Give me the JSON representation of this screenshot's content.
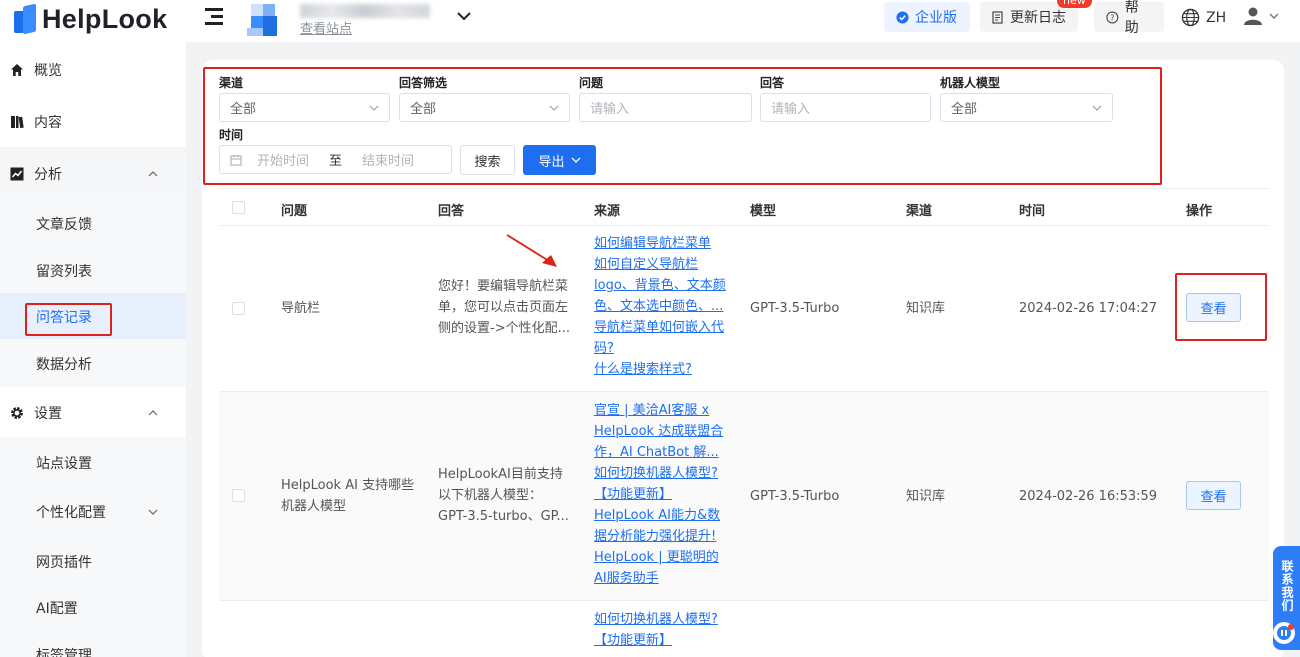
{
  "header": {
    "logo_text": "HelpLook",
    "site_link": "查看站点",
    "enterprise_label": "企业版",
    "changelog_label": "更新日志",
    "new_badge": "new",
    "help_label": "帮助",
    "lang_label": "ZH"
  },
  "sidebar": {
    "items": [
      {
        "label": "概览",
        "icon": "home-icon"
      },
      {
        "label": "内容",
        "icon": "book-icon"
      },
      {
        "label": "分析",
        "icon": "chart-icon"
      },
      {
        "label": "文章反馈"
      },
      {
        "label": "留资列表"
      },
      {
        "label": "问答记录"
      },
      {
        "label": "数据分析"
      },
      {
        "label": "设置",
        "icon": "gear-icon"
      },
      {
        "label": "站点设置"
      },
      {
        "label": "个性化配置"
      },
      {
        "label": "网页插件"
      },
      {
        "label": "AI配置"
      },
      {
        "label": "标签管理"
      }
    ]
  },
  "filters": {
    "channel_label": "渠道",
    "channel_value": "全部",
    "answer_filter_label": "回答筛选",
    "answer_filter_value": "全部",
    "question_label": "问题",
    "question_placeholder": "请输入",
    "answer_label": "回答",
    "answer_placeholder": "请输入",
    "model_label": "机器人模型",
    "model_value": "全部",
    "time_label": "时间",
    "start_placeholder": "开始时间",
    "range_sep": "至",
    "end_placeholder": "结束时间",
    "search_button": "搜索",
    "export_button": "导出"
  },
  "table": {
    "columns": [
      "问题",
      "回答",
      "来源",
      "模型",
      "渠道",
      "时间",
      "操作"
    ],
    "rows": [
      {
        "question": "导航栏",
        "answer": [
          "您好！要编辑导航栏菜",
          "单，您可以点击页面左",
          "侧的设置->个性化配..."
        ],
        "sources": [
          "如何编辑导航栏菜单",
          "如何自定义导航栏",
          "logo、背景色、文本颜",
          "色、文本选中颜色、...",
          "导航栏菜单如何嵌入代",
          "码?",
          "什么是搜索样式?"
        ],
        "model": "GPT-3.5-Turbo",
        "channel": "知识库",
        "time": "2024-02-26 17:04:27",
        "action": "查看"
      },
      {
        "question": [
          "HelpLook AI 支持哪些",
          "机器人模型"
        ],
        "answer": [
          "HelpLookAI目前支持",
          "以下机器人模型：",
          "GPT-3.5-turbo、GP..."
        ],
        "sources": [
          "官宣 | 美洽AI客服 x",
          "HelpLook 达成联盟合",
          "作，AI ChatBot 解...",
          "如何切换机器人模型?",
          "【功能更新】",
          "HelpLook AI能力&数",
          "据分析能力强化提升!",
          "HelpLook | 更聪明的",
          "AI服务助手"
        ],
        "model": "GPT-3.5-Turbo",
        "channel": "知识库",
        "time": "2024-02-26 16:53:59",
        "action": "查看"
      },
      {
        "sources": [
          "如何切换机器人模型?",
          "【功能更新】"
        ]
      }
    ]
  },
  "float_contact": "联系我们"
}
